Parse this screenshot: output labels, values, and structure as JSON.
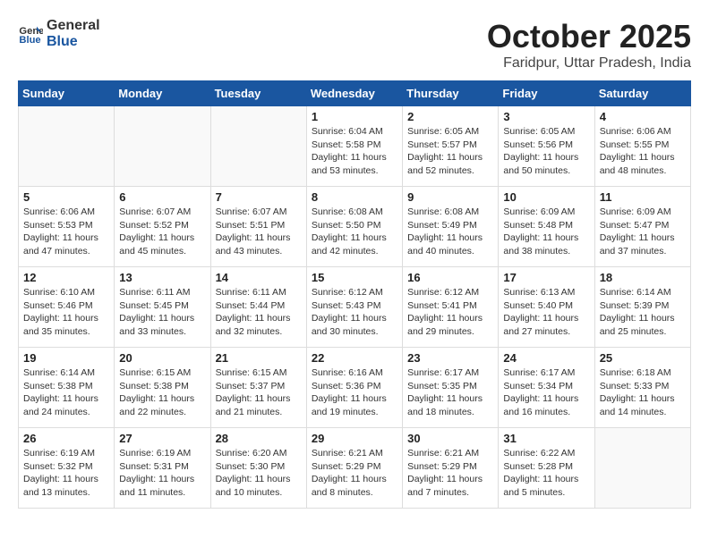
{
  "header": {
    "logo_general": "General",
    "logo_blue": "Blue",
    "title": "October 2025",
    "subtitle": "Faridpur, Uttar Pradesh, India"
  },
  "days_of_week": [
    "Sunday",
    "Monday",
    "Tuesday",
    "Wednesday",
    "Thursday",
    "Friday",
    "Saturday"
  ],
  "weeks": [
    [
      {
        "day": "",
        "info": ""
      },
      {
        "day": "",
        "info": ""
      },
      {
        "day": "",
        "info": ""
      },
      {
        "day": "1",
        "info": "Sunrise: 6:04 AM\nSunset: 5:58 PM\nDaylight: 11 hours and 53 minutes."
      },
      {
        "day": "2",
        "info": "Sunrise: 6:05 AM\nSunset: 5:57 PM\nDaylight: 11 hours and 52 minutes."
      },
      {
        "day": "3",
        "info": "Sunrise: 6:05 AM\nSunset: 5:56 PM\nDaylight: 11 hours and 50 minutes."
      },
      {
        "day": "4",
        "info": "Sunrise: 6:06 AM\nSunset: 5:55 PM\nDaylight: 11 hours and 48 minutes."
      }
    ],
    [
      {
        "day": "5",
        "info": "Sunrise: 6:06 AM\nSunset: 5:53 PM\nDaylight: 11 hours and 47 minutes."
      },
      {
        "day": "6",
        "info": "Sunrise: 6:07 AM\nSunset: 5:52 PM\nDaylight: 11 hours and 45 minutes."
      },
      {
        "day": "7",
        "info": "Sunrise: 6:07 AM\nSunset: 5:51 PM\nDaylight: 11 hours and 43 minutes."
      },
      {
        "day": "8",
        "info": "Sunrise: 6:08 AM\nSunset: 5:50 PM\nDaylight: 11 hours and 42 minutes."
      },
      {
        "day": "9",
        "info": "Sunrise: 6:08 AM\nSunset: 5:49 PM\nDaylight: 11 hours and 40 minutes."
      },
      {
        "day": "10",
        "info": "Sunrise: 6:09 AM\nSunset: 5:48 PM\nDaylight: 11 hours and 38 minutes."
      },
      {
        "day": "11",
        "info": "Sunrise: 6:09 AM\nSunset: 5:47 PM\nDaylight: 11 hours and 37 minutes."
      }
    ],
    [
      {
        "day": "12",
        "info": "Sunrise: 6:10 AM\nSunset: 5:46 PM\nDaylight: 11 hours and 35 minutes."
      },
      {
        "day": "13",
        "info": "Sunrise: 6:11 AM\nSunset: 5:45 PM\nDaylight: 11 hours and 33 minutes."
      },
      {
        "day": "14",
        "info": "Sunrise: 6:11 AM\nSunset: 5:44 PM\nDaylight: 11 hours and 32 minutes."
      },
      {
        "day": "15",
        "info": "Sunrise: 6:12 AM\nSunset: 5:43 PM\nDaylight: 11 hours and 30 minutes."
      },
      {
        "day": "16",
        "info": "Sunrise: 6:12 AM\nSunset: 5:41 PM\nDaylight: 11 hours and 29 minutes."
      },
      {
        "day": "17",
        "info": "Sunrise: 6:13 AM\nSunset: 5:40 PM\nDaylight: 11 hours and 27 minutes."
      },
      {
        "day": "18",
        "info": "Sunrise: 6:14 AM\nSunset: 5:39 PM\nDaylight: 11 hours and 25 minutes."
      }
    ],
    [
      {
        "day": "19",
        "info": "Sunrise: 6:14 AM\nSunset: 5:38 PM\nDaylight: 11 hours and 24 minutes."
      },
      {
        "day": "20",
        "info": "Sunrise: 6:15 AM\nSunset: 5:38 PM\nDaylight: 11 hours and 22 minutes."
      },
      {
        "day": "21",
        "info": "Sunrise: 6:15 AM\nSunset: 5:37 PM\nDaylight: 11 hours and 21 minutes."
      },
      {
        "day": "22",
        "info": "Sunrise: 6:16 AM\nSunset: 5:36 PM\nDaylight: 11 hours and 19 minutes."
      },
      {
        "day": "23",
        "info": "Sunrise: 6:17 AM\nSunset: 5:35 PM\nDaylight: 11 hours and 18 minutes."
      },
      {
        "day": "24",
        "info": "Sunrise: 6:17 AM\nSunset: 5:34 PM\nDaylight: 11 hours and 16 minutes."
      },
      {
        "day": "25",
        "info": "Sunrise: 6:18 AM\nSunset: 5:33 PM\nDaylight: 11 hours and 14 minutes."
      }
    ],
    [
      {
        "day": "26",
        "info": "Sunrise: 6:19 AM\nSunset: 5:32 PM\nDaylight: 11 hours and 13 minutes."
      },
      {
        "day": "27",
        "info": "Sunrise: 6:19 AM\nSunset: 5:31 PM\nDaylight: 11 hours and 11 minutes."
      },
      {
        "day": "28",
        "info": "Sunrise: 6:20 AM\nSunset: 5:30 PM\nDaylight: 11 hours and 10 minutes."
      },
      {
        "day": "29",
        "info": "Sunrise: 6:21 AM\nSunset: 5:29 PM\nDaylight: 11 hours and 8 minutes."
      },
      {
        "day": "30",
        "info": "Sunrise: 6:21 AM\nSunset: 5:29 PM\nDaylight: 11 hours and 7 minutes."
      },
      {
        "day": "31",
        "info": "Sunrise: 6:22 AM\nSunset: 5:28 PM\nDaylight: 11 hours and 5 minutes."
      },
      {
        "day": "",
        "info": ""
      }
    ]
  ]
}
